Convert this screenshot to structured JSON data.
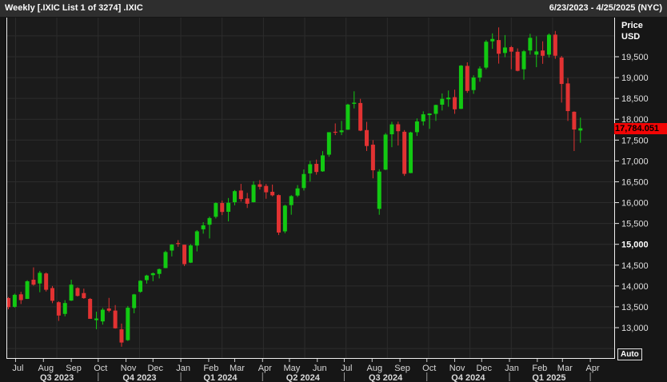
{
  "titlebar": {
    "title": "Weekly [.IXIC List 1 of 3274] .IXIC",
    "date_range": "6/23/2023 - 4/25/2025 (NYC)"
  },
  "price_axis": {
    "header_line1": "Price",
    "header_line2": "USD",
    "last_price_label": "17,784.051"
  },
  "controls": {
    "auto_button_label": "Auto"
  },
  "chart_data": {
    "type": "candlestick",
    "title": "Weekly [.IXIC List 1 of 3274] .IXIC",
    "symbol": ".IXIC",
    "interval": "weekly",
    "timezone": "NYC",
    "x_range": [
      "2023-06-23",
      "2025-04-25"
    ],
    "first_candle_week_ending": "2023-06-23",
    "last_candle_week_ending": "2025-03-21",
    "ylabel": "Price USD",
    "ylim": [
      12350,
      20450
    ],
    "grid": true,
    "up_color": "#12c912",
    "down_color": "#e23232",
    "last_price": 17784.051,
    "y_ticks": [
      {
        "label": "19,500",
        "value": 19500,
        "bold": false
      },
      {
        "label": "19,000",
        "value": 19000,
        "bold": false
      },
      {
        "label": "18,500",
        "value": 18500,
        "bold": false
      },
      {
        "label": "18,000",
        "value": 18000,
        "bold": false
      },
      {
        "label": "17,500",
        "value": 17500,
        "bold": false
      },
      {
        "label": "17,000",
        "value": 17000,
        "bold": false
      },
      {
        "label": "16,500",
        "value": 16500,
        "bold": false
      },
      {
        "label": "16,000",
        "value": 16000,
        "bold": false
      },
      {
        "label": "15,500",
        "value": 15500,
        "bold": false
      },
      {
        "label": "15,000",
        "value": 15000,
        "bold": true
      },
      {
        "label": "14,500",
        "value": 14500,
        "bold": false
      },
      {
        "label": "14,000",
        "value": 14000,
        "bold": false
      },
      {
        "label": "13,500",
        "value": 13500,
        "bold": false
      },
      {
        "label": "13,000",
        "value": 13000,
        "bold": false
      }
    ],
    "x_axis": {
      "months": [
        {
          "label": "Jul",
          "week": 1.14
        },
        {
          "label": "Aug",
          "week": 5.57
        },
        {
          "label": "Sep",
          "week": 10.0
        },
        {
          "label": "Oct",
          "week": 14.29
        },
        {
          "label": "Nov",
          "week": 18.71
        },
        {
          "label": "Dec",
          "week": 23.0
        },
        {
          "label": "Jan",
          "week": 27.43
        },
        {
          "label": "Feb",
          "week": 31.86
        },
        {
          "label": "Mar",
          "week": 36.0
        },
        {
          "label": "Apr",
          "week": 40.43
        },
        {
          "label": "May",
          "week": 44.71
        },
        {
          "label": "Jun",
          "week": 49.14
        },
        {
          "label": "Jul",
          "week": 53.43
        },
        {
          "label": "Aug",
          "week": 57.86
        },
        {
          "label": "Sep",
          "week": 62.29
        },
        {
          "label": "Oct",
          "week": 66.57
        },
        {
          "label": "Nov",
          "week": 71.0
        },
        {
          "label": "Dec",
          "week": 75.29
        },
        {
          "label": "Jan",
          "week": 79.71
        },
        {
          "label": "Feb",
          "week": 84.14
        },
        {
          "label": "Mar",
          "week": 88.14
        },
        {
          "label": "Apr",
          "week": 92.57
        }
      ],
      "quarters": [
        {
          "label": "Q3 2023",
          "mid_week": 7.71,
          "end_week": 14.29
        },
        {
          "label": "Q4 2023",
          "mid_week": 20.86,
          "end_week": 27.43
        },
        {
          "label": "Q1 2024",
          "mid_week": 33.71,
          "end_week": 40.43
        },
        {
          "label": "Q2 2024",
          "mid_week": 46.86,
          "end_week": 53.43
        },
        {
          "label": "Q3 2024",
          "mid_week": 60.0,
          "end_week": 66.57
        },
        {
          "label": "Q4 2024",
          "mid_week": 73.14,
          "end_week": 79.71
        },
        {
          "label": "Q1 2025",
          "mid_week": 86.0,
          "end_week": 92.57
        }
      ]
    },
    "candles_ohlc": [
      [
        13710,
        13733,
        13442,
        13493
      ],
      [
        13500,
        13816,
        13480,
        13788
      ],
      [
        13800,
        13860,
        13567,
        13661
      ],
      [
        13690,
        14138,
        13688,
        14113
      ],
      [
        14150,
        14446,
        14007,
        14032
      ],
      [
        14060,
        14360,
        13850,
        14316
      ],
      [
        14300,
        14324,
        13868,
        13909
      ],
      [
        13950,
        13999,
        13588,
        13645
      ],
      [
        13610,
        13632,
        13162,
        13291
      ],
      [
        13330,
        13660,
        13272,
        13591
      ],
      [
        13650,
        14150,
        13640,
        14032
      ],
      [
        13950,
        13970,
        13748,
        13762
      ],
      [
        13830,
        13937,
        13691,
        13708
      ],
      [
        13690,
        13711,
        13223,
        13212
      ],
      [
        13180,
        13383,
        12963,
        13219
      ],
      [
        13150,
        13472,
        13072,
        13431
      ],
      [
        13460,
        13714,
        13371,
        13407
      ],
      [
        13410,
        13542,
        12977,
        12984
      ],
      [
        12960,
        13098,
        12543,
        12643
      ],
      [
        12700,
        13520,
        12680,
        13478
      ],
      [
        13470,
        13810,
        13345,
        13798
      ],
      [
        13860,
        14136,
        13840,
        14125
      ],
      [
        14140,
        14269,
        14056,
        14251
      ],
      [
        14260,
        14325,
        14115,
        14305
      ],
      [
        14290,
        14418,
        14181,
        14404
      ],
      [
        14430,
        14846,
        14426,
        14814
      ],
      [
        14850,
        15004,
        14708,
        14993
      ],
      [
        15030,
        15100,
        14940,
        15011
      ],
      [
        14990,
        14990,
        14477,
        14524
      ],
      [
        14560,
        15005,
        14550,
        14973
      ],
      [
        14970,
        15340,
        14830,
        15311
      ],
      [
        15360,
        15530,
        15255,
        15455
      ],
      [
        15470,
        15665,
        15140,
        15629
      ],
      [
        15660,
        16007,
        15620,
        15990
      ],
      [
        15990,
        16050,
        15700,
        15776
      ],
      [
        15780,
        16110,
        15550,
        15997
      ],
      [
        16010,
        16302,
        15935,
        16275
      ],
      [
        16290,
        16449,
        16025,
        16085
      ],
      [
        16100,
        16233,
        15871,
        15973
      ],
      [
        16010,
        16512,
        16005,
        16428
      ],
      [
        16440,
        16540,
        16315,
        16379
      ],
      [
        16400,
        16448,
        16092,
        16248
      ],
      [
        16260,
        16433,
        16150,
        16175
      ],
      [
        16180,
        16195,
        15222,
        15282
      ],
      [
        15310,
        15950,
        15265,
        15928
      ],
      [
        15940,
        16180,
        15710,
        16156
      ],
      [
        16170,
        16420,
        16135,
        16341
      ],
      [
        16350,
        16796,
        16290,
        16686
      ],
      [
        16700,
        17000,
        16505,
        16921
      ],
      [
        16930,
        17032,
        16670,
        16735
      ],
      [
        16750,
        17235,
        16740,
        17133
      ],
      [
        17150,
        17690,
        17100,
        17689
      ],
      [
        17700,
        17900,
        17620,
        17689
      ],
      [
        17690,
        17960,
        17620,
        17732
      ],
      [
        17750,
        18372,
        17745,
        18353
      ],
      [
        18370,
        18671,
        18260,
        18398
      ],
      [
        18390,
        18490,
        17715,
        17727
      ],
      [
        17740,
        17937,
        17238,
        17358
      ],
      [
        17390,
        17500,
        16582,
        16776
      ],
      [
        15850,
        16800,
        15708,
        16745
      ],
      [
        16791,
        17670,
        16780,
        17632
      ],
      [
        17640,
        17940,
        17330,
        17877
      ],
      [
        17880,
        17943,
        17370,
        17713
      ],
      [
        17700,
        17740,
        16640,
        16690
      ],
      [
        16710,
        17700,
        16705,
        17684
      ],
      [
        17690,
        18020,
        17600,
        17948
      ],
      [
        17950,
        18190,
        17850,
        18119
      ],
      [
        18100,
        18145,
        17770,
        18138
      ],
      [
        18130,
        18350,
        17960,
        18343
      ],
      [
        18350,
        18620,
        18210,
        18490
      ],
      [
        18480,
        18690,
        18300,
        18519
      ],
      [
        18530,
        18710,
        18130,
        18239
      ],
      [
        18250,
        19300,
        18245,
        19287
      ],
      [
        19280,
        19366,
        18633,
        18680
      ],
      [
        18700,
        19055,
        18610,
        19003
      ],
      [
        19000,
        19270,
        18900,
        19218
      ],
      [
        19240,
        19900,
        19200,
        19860
      ],
      [
        19870,
        20061,
        19690,
        19927
      ],
      [
        19900,
        20204,
        19335,
        19572
      ],
      [
        19590,
        20020,
        19490,
        19722
      ],
      [
        19730,
        19760,
        19200,
        19622
      ],
      [
        19620,
        19700,
        19150,
        19162
      ],
      [
        19200,
        19660,
        18950,
        19630
      ],
      [
        19650,
        20050,
        19550,
        19954
      ],
      [
        19550,
        19990,
        19250,
        19627
      ],
      [
        19650,
        19870,
        19330,
        19523
      ],
      [
        19550,
        20059,
        19480,
        20027
      ],
      [
        20030,
        20118,
        19450,
        19524
      ],
      [
        19480,
        19520,
        18400,
        18847
      ],
      [
        18860,
        18990,
        17960,
        18196
      ],
      [
        18180,
        18190,
        17238,
        17754
      ],
      [
        17730,
        18040,
        17437,
        17784.051
      ]
    ]
  }
}
